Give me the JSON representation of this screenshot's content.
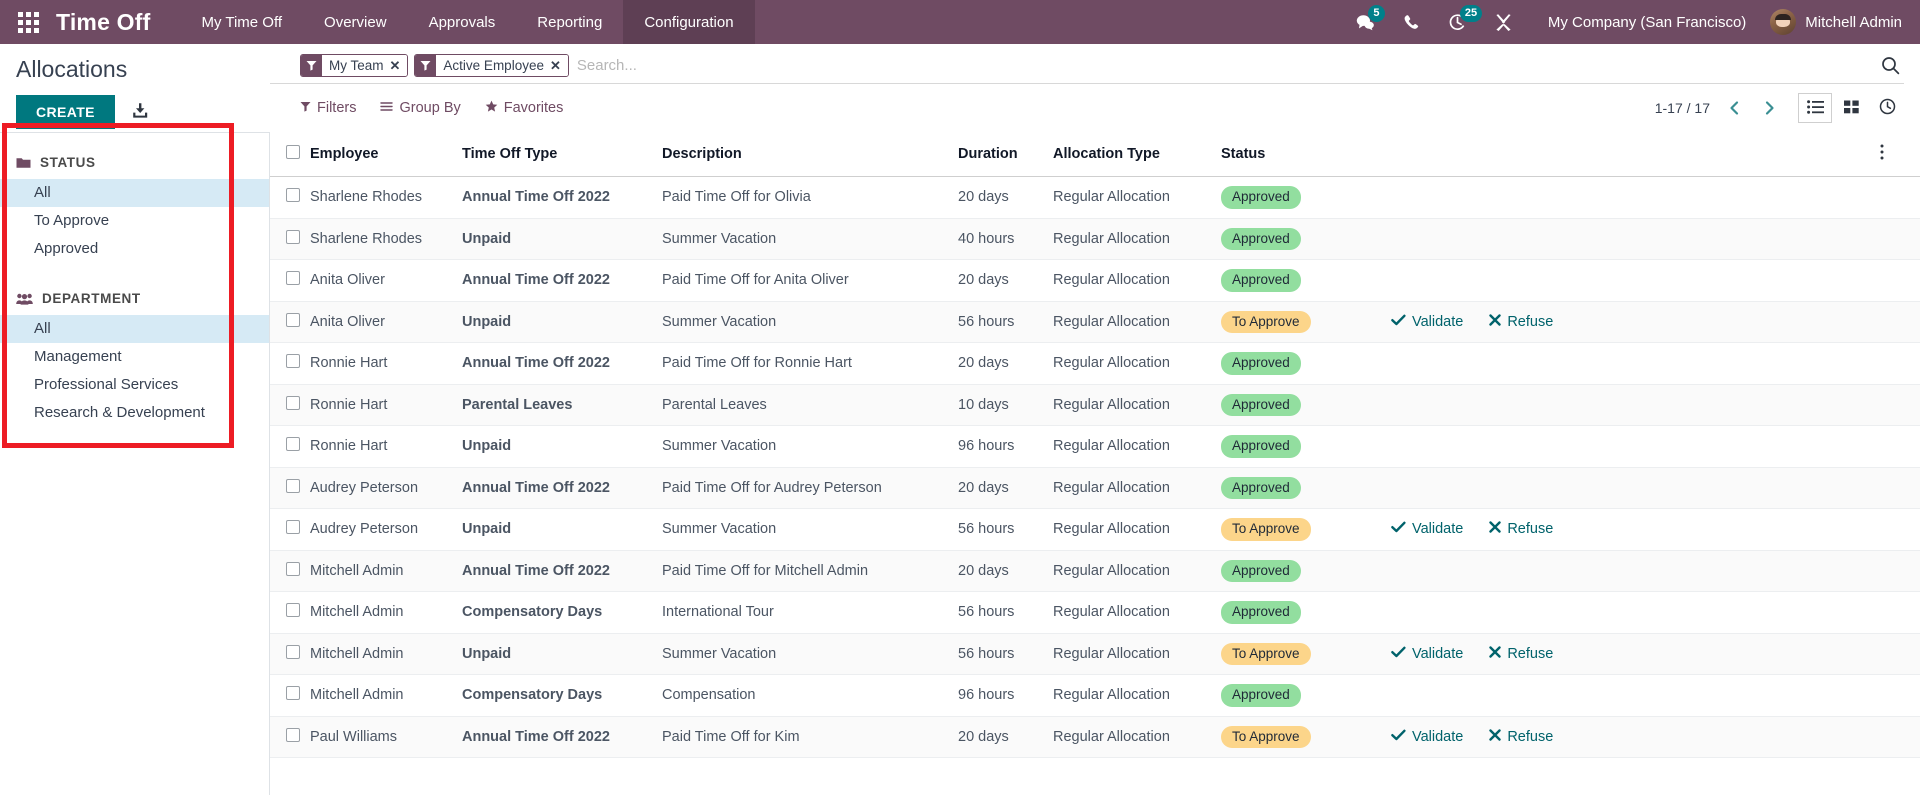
{
  "navbar": {
    "apps_icon": "apps-grid-icon",
    "brand": "Time Off",
    "menu": [
      {
        "label": "My Time Off",
        "active": false
      },
      {
        "label": "Overview",
        "active": false
      },
      {
        "label": "Approvals",
        "active": false
      },
      {
        "label": "Reporting",
        "active": false
      },
      {
        "label": "Configuration",
        "active": true
      }
    ],
    "systray": {
      "messages": {
        "icon": "chat-bubble-icon",
        "count": "5"
      },
      "phone": {
        "icon": "phone-icon",
        "count": ""
      },
      "activities": {
        "icon": "clock-icon",
        "count": "25"
      },
      "debug": {
        "icon": "wrench-icon",
        "count": ""
      }
    },
    "company": "My Company (San Francisco)",
    "user": "Mitchell Admin",
    "brand_color": "#6f4b63",
    "badge_color": "#00808a"
  },
  "control_panel": {
    "title": "Allocations",
    "create_label": "CREATE",
    "export_icon": "download-icon",
    "search": {
      "placeholder": "Search...",
      "search_icon": "search-icon",
      "facets": [
        {
          "icon": "filter-icon",
          "label": "My Team",
          "remove": "✕"
        },
        {
          "icon": "filter-icon",
          "label": "Active Employee",
          "remove": "✕"
        }
      ]
    },
    "toolbar": [
      {
        "label": "Filters",
        "icon": "filter-icon"
      },
      {
        "label": "Group By",
        "icon": "list-lines-icon"
      },
      {
        "label": "Favorites",
        "icon": "star-icon"
      }
    ],
    "pager": {
      "range": "1-17 / 17",
      "prev_icon": "chevron-left-icon",
      "next_icon": "chevron-right-icon"
    },
    "views": [
      {
        "name": "list-view",
        "icon": "list-view-icon",
        "active": true
      },
      {
        "name": "kanban-view",
        "icon": "kanban-view-icon",
        "active": false
      },
      {
        "name": "activity-view",
        "icon": "activity-clock-icon",
        "active": false
      }
    ]
  },
  "sidebar": {
    "sections": [
      {
        "title": "STATUS",
        "icon": "folder-icon",
        "items": [
          {
            "label": "All",
            "selected": true
          },
          {
            "label": "To Approve",
            "selected": false
          },
          {
            "label": "Approved",
            "selected": false
          }
        ]
      },
      {
        "title": "DEPARTMENT",
        "icon": "people-icon",
        "items": [
          {
            "label": "All",
            "selected": true
          },
          {
            "label": "Management",
            "selected": false
          },
          {
            "label": "Professional Services",
            "selected": false
          },
          {
            "label": "Research & Development",
            "selected": false
          }
        ]
      }
    ],
    "annotation": {
      "color": "#ed1c24",
      "shape": "rectangle-highlight"
    }
  },
  "table": {
    "columns": [
      "Employee",
      "Time Off Type",
      "Description",
      "Duration",
      "Allocation Type",
      "Status"
    ],
    "options_icon": "vertical-dots-icon",
    "select_all": "select-all-checkbox",
    "action_labels": {
      "validate": "Validate",
      "refuse": "Refuse"
    },
    "status_colors": {
      "approved": "#92de9f",
      "to_approve": "#fcd58a"
    },
    "rows": [
      {
        "employee": "Sharlene Rhodes",
        "type": "Annual Time Off 2022",
        "description": "Paid Time Off for Olivia",
        "duration": "20 days",
        "allocation_type": "Regular Allocation",
        "status": "Approved",
        "status_kind": "approved",
        "actions": false
      },
      {
        "employee": "Sharlene Rhodes",
        "type": "Unpaid",
        "description": "Summer Vacation",
        "duration": "40 hours",
        "allocation_type": "Regular Allocation",
        "status": "Approved",
        "status_kind": "approved",
        "actions": false
      },
      {
        "employee": "Anita Oliver",
        "type": "Annual Time Off 2022",
        "description": "Paid Time Off for Anita Oliver",
        "duration": "20 days",
        "allocation_type": "Regular Allocation",
        "status": "Approved",
        "status_kind": "approved",
        "actions": false
      },
      {
        "employee": "Anita Oliver",
        "type": "Unpaid",
        "description": "Summer Vacation",
        "duration": "56 hours",
        "allocation_type": "Regular Allocation",
        "status": "To Approve",
        "status_kind": "to-approve",
        "actions": true
      },
      {
        "employee": "Ronnie Hart",
        "type": "Annual Time Off 2022",
        "description": "Paid Time Off for Ronnie Hart",
        "duration": "20 days",
        "allocation_type": "Regular Allocation",
        "status": "Approved",
        "status_kind": "approved",
        "actions": false
      },
      {
        "employee": "Ronnie Hart",
        "type": "Parental Leaves",
        "description": "Parental Leaves",
        "duration": "10 days",
        "allocation_type": "Regular Allocation",
        "status": "Approved",
        "status_kind": "approved",
        "actions": false
      },
      {
        "employee": "Ronnie Hart",
        "type": "Unpaid",
        "description": "Summer Vacation",
        "duration": "96 hours",
        "allocation_type": "Regular Allocation",
        "status": "Approved",
        "status_kind": "approved",
        "actions": false
      },
      {
        "employee": "Audrey Peterson",
        "type": "Annual Time Off 2022",
        "description": "Paid Time Off for Audrey Peterson",
        "duration": "20 days",
        "allocation_type": "Regular Allocation",
        "status": "Approved",
        "status_kind": "approved",
        "actions": false
      },
      {
        "employee": "Audrey Peterson",
        "type": "Unpaid",
        "description": "Summer Vacation",
        "duration": "56 hours",
        "allocation_type": "Regular Allocation",
        "status": "To Approve",
        "status_kind": "to-approve",
        "actions": true
      },
      {
        "employee": "Mitchell Admin",
        "type": "Annual Time Off 2022",
        "description": "Paid Time Off for Mitchell Admin",
        "duration": "20 days",
        "allocation_type": "Regular Allocation",
        "status": "Approved",
        "status_kind": "approved",
        "actions": false
      },
      {
        "employee": "Mitchell Admin",
        "type": "Compensatory Days",
        "description": "International Tour",
        "duration": "56 hours",
        "allocation_type": "Regular Allocation",
        "status": "Approved",
        "status_kind": "approved",
        "actions": false
      },
      {
        "employee": "Mitchell Admin",
        "type": "Unpaid",
        "description": "Summer Vacation",
        "duration": "56 hours",
        "allocation_type": "Regular Allocation",
        "status": "To Approve",
        "status_kind": "to-approve",
        "actions": true
      },
      {
        "employee": "Mitchell Admin",
        "type": "Compensatory Days",
        "description": "Compensation",
        "duration": "96 hours",
        "allocation_type": "Regular Allocation",
        "status": "Approved",
        "status_kind": "approved",
        "actions": false
      },
      {
        "employee": "Paul Williams",
        "type": "Annual Time Off 2022",
        "description": "Paid Time Off for Kim",
        "duration": "20 days",
        "allocation_type": "Regular Allocation",
        "status": "To Approve",
        "status_kind": "to-approve",
        "actions": true
      }
    ]
  }
}
